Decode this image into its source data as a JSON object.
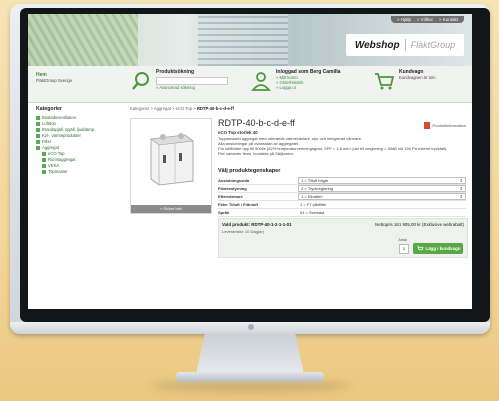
{
  "top_links": [
    "» Hjälp",
    "» Villkor",
    "» Kontakt"
  ],
  "brand": {
    "webshop": "Webshop",
    "company": "FläktGroup"
  },
  "info": {
    "home": "Hem",
    "home_sub": "FläktGroup Sverige",
    "search_title": "Produktsökning",
    "search_placeholder": "",
    "advanced_search": "» Avancerad sökning",
    "user_title": "Inloggad som Berg Camilla",
    "user_links": [
      "» Mitt konto",
      "» Orderhistorik",
      "» Logga ut"
    ],
    "cart_title": "Kundvagn",
    "cart_status": "Kundvagnen är tom."
  },
  "sidebar": {
    "heading": "Kategorier",
    "items": [
      {
        "label": "Bostadsventilation",
        "sub": false
      },
      {
        "label": "Luftdon",
        "sub": false
      },
      {
        "label": "Brandspjäll, spjäll, ljuddämp.",
        "sub": false
      },
      {
        "label": "Kyl-, värmeprodukter",
        "sub": false
      },
      {
        "label": "Filter",
        "sub": false
      },
      {
        "label": "Aggregat",
        "sub": false
      },
      {
        "label": "eCO Top",
        "sub": true
      },
      {
        "label": "Rumsaggregat",
        "sub": true
      },
      {
        "label": "VEKA",
        "sub": true
      },
      {
        "label": "Topmaster",
        "sub": true
      }
    ]
  },
  "breadcrumb": {
    "path": "Kategorier > Aggregat > eCO Top > ",
    "current": "RDTP-40-b-c-d-e-ff"
  },
  "product": {
    "title": "RDTP-40-b-c-d-e-ff",
    "subtitle": "eCO Top storlek 40",
    "pdf_label": "Produktinformation",
    "description": [
      "Toppanslutet aggregat med roterande värmeväxlare, styr och integrerad värmare.",
      "Alla anslutningar på ovansidan av aggregatet.",
      "För luftflöden upp till 500l/s (82% temperaturverkningsgrad, SFP = 1,8 och i just till omgivning = 53dB vid 150 Pa externt tryckfall).",
      "Fler varianter finns, kontakta på Säljkontor."
    ],
    "more_images": "» Större bild"
  },
  "options": {
    "heading": "Välj produktegenskaper",
    "rows": [
      {
        "label": "Anslutningssida",
        "value": "1 = Tilluft höger",
        "select": true
      },
      {
        "label": "Flödesstyrning",
        "value": "2 = Tryckreglering",
        "select": true
      },
      {
        "label": "Eftervärmare",
        "value": "1 = Elbatteri",
        "select": true
      },
      {
        "label": "Filter Tilluft / Frånluft",
        "value": "1 = F7 påsfilter",
        "select": false
      },
      {
        "label": "Språk",
        "value": "01 = Svenska",
        "select": false
      }
    ]
  },
  "summary": {
    "selected": "Vald produkt: RDTP-40-1-2-1-1-01",
    "net_price": "Nettopris 161 905,00 kr (Exklusive webrabatt)",
    "lead_time": "Leveranstid: 10 Dag(ar)",
    "qty_label": "Antal",
    "qty": "1",
    "add_to_cart": "Lägg i kundvagn"
  }
}
